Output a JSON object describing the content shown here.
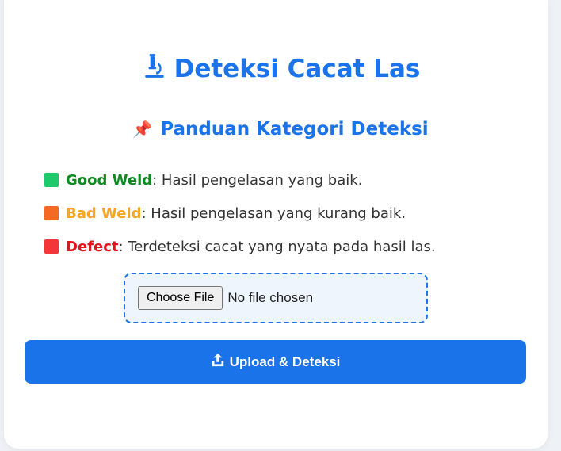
{
  "header": {
    "title": "Deteksi Cacat Las",
    "title_icon": "microscope-icon",
    "accent": "#1a73e8"
  },
  "guide": {
    "heading": "Panduan Kategori Deteksi",
    "heading_icon": "pushpin-icon",
    "items": [
      {
        "name": "Good Weld",
        "desc": ": Hasil pengelasan yang baik.",
        "color": "#0a8a1f",
        "square": "#1ec96b"
      },
      {
        "name": "Bad Weld",
        "desc": ": Hasil pengelasan yang kurang baik.",
        "color": "#f5a623",
        "square": "#f46a25"
      },
      {
        "name": "Defect",
        "desc": ": Terdeteksi cacat yang nyata pada hasil las.",
        "color": "#e0161e",
        "square": "#f4363a"
      }
    ]
  },
  "upload": {
    "choose_label": "Choose File",
    "status": "No file chosen",
    "submit_label": "Upload & Deteksi",
    "submit_icon": "upload-icon"
  }
}
